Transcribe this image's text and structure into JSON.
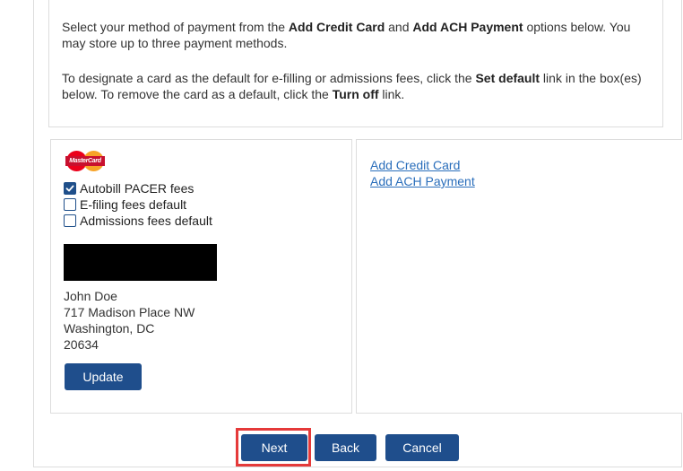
{
  "instructions": {
    "p1_a": "Select your method of payment from the ",
    "p1_b": "Add Credit Card",
    "p1_c": " and ",
    "p1_d": "Add ACH Payment",
    "p1_e": " options below. You may store up to three payment methods.",
    "p2_a": "To designate a card as the default for e-filling or admissions fees, click the ",
    "p2_b": "Set default",
    "p2_c": " link in the box(es) below. To remove the card as a default, click the ",
    "p2_d": "Turn off",
    "p2_e": " link."
  },
  "card": {
    "logo_icon": "mastercard-logo",
    "logo_text": "MasterCard",
    "options": [
      {
        "label": "Autobill PACER fees",
        "checked": true
      },
      {
        "label": "E-filing fees default",
        "checked": false
      },
      {
        "label": "Admissions fees default",
        "checked": false
      }
    ],
    "address": {
      "name": "John Doe",
      "street": "717 Madison Place NW",
      "city_state": "Washington, DC",
      "zip": "20634"
    },
    "update_label": "Update"
  },
  "links": {
    "add_credit_card": "Add Credit Card",
    "add_ach_payment": "Add ACH Payment"
  },
  "actions": {
    "next_label": "Next",
    "back_label": "Back",
    "cancel_label": "Cancel",
    "highlight_color": "#e53a3a"
  },
  "colors": {
    "button": "#1f4e8c",
    "link": "#2a6ebb"
  }
}
